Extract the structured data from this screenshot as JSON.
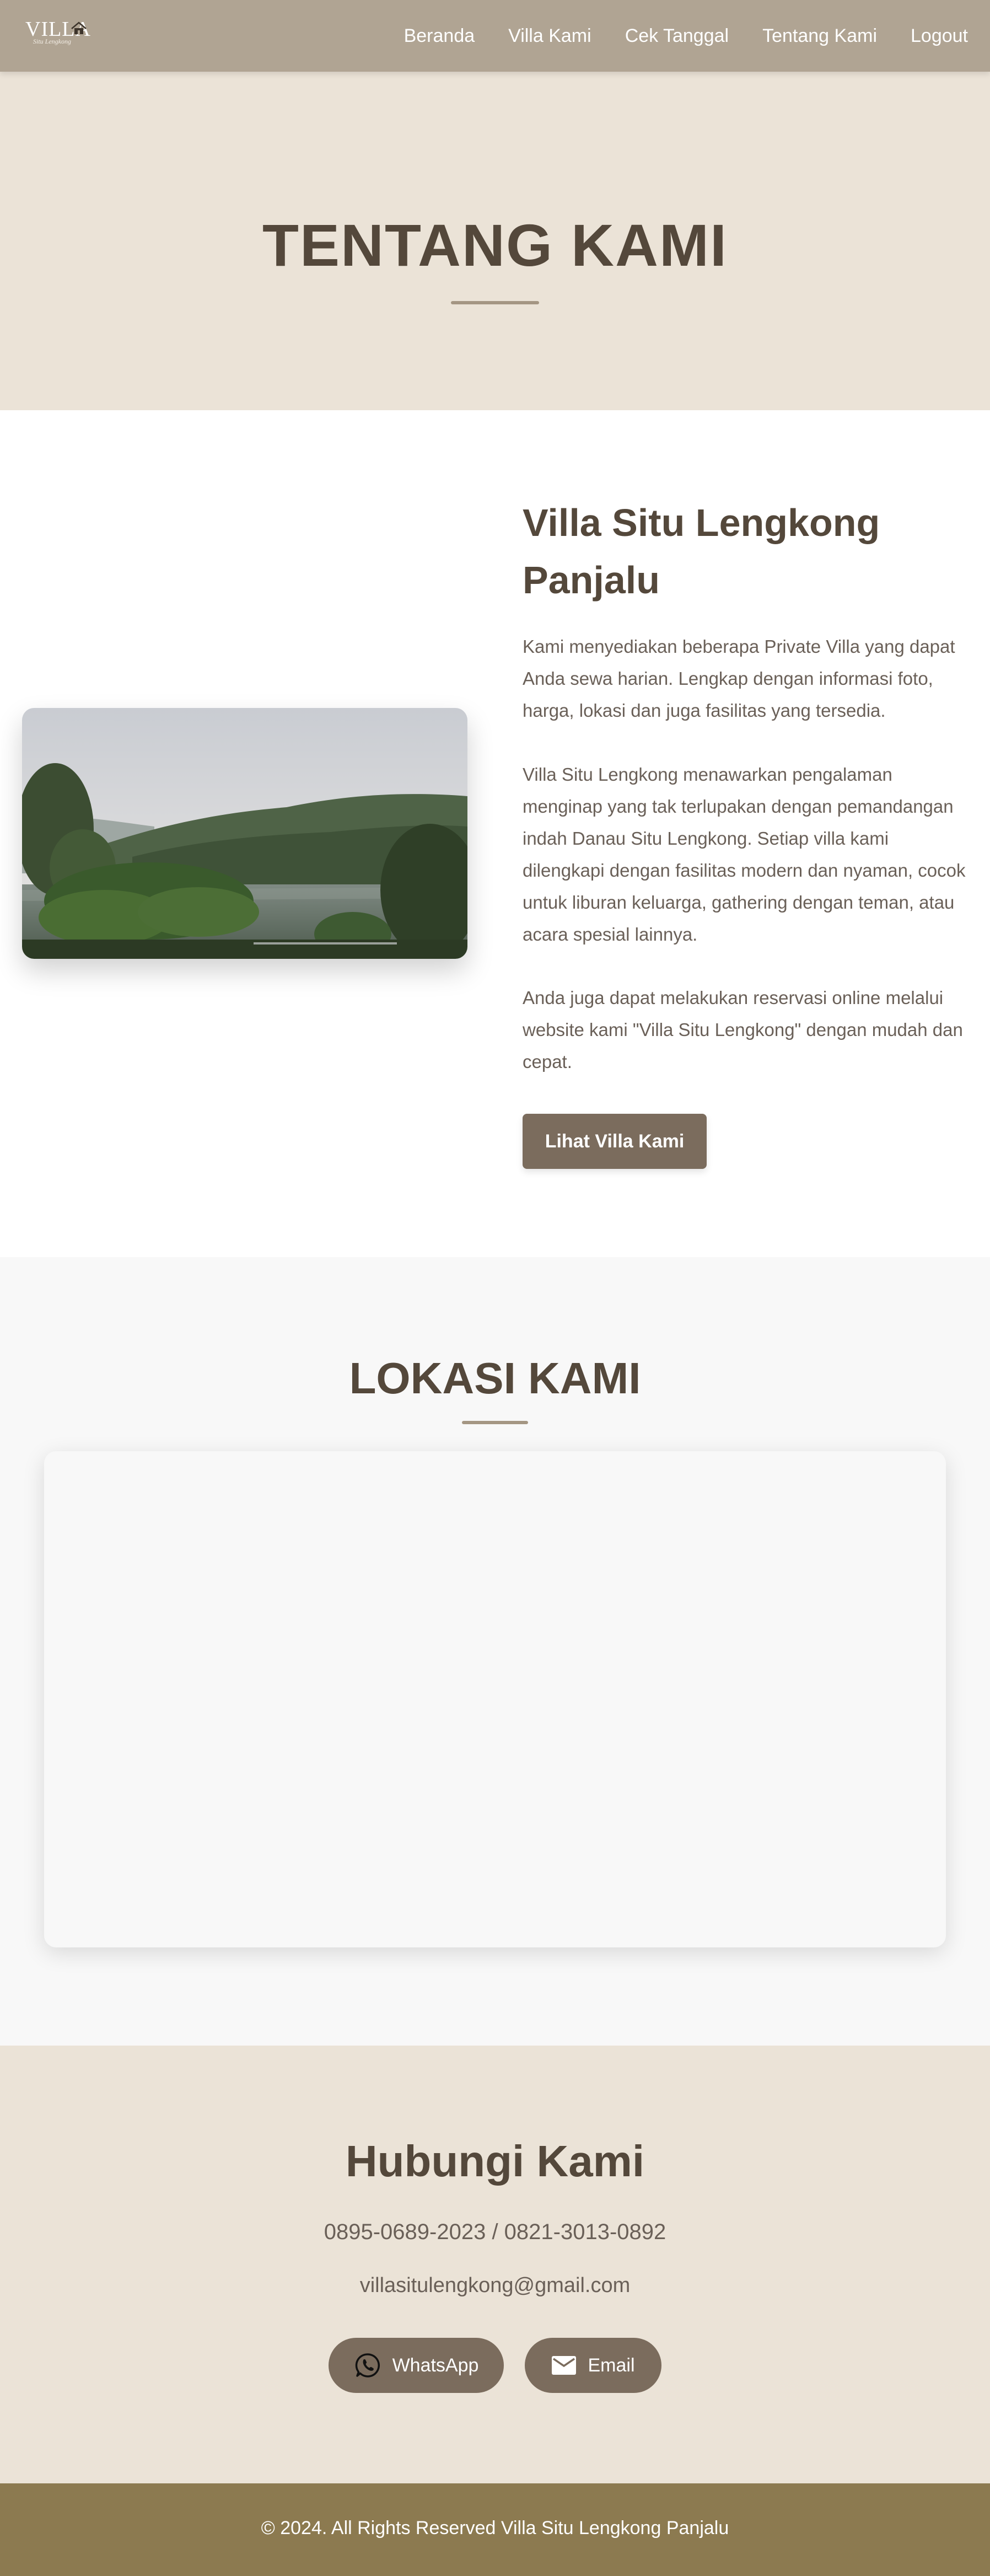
{
  "navbar": {
    "logo": {
      "text": "VILLA",
      "subtext": "Situ Lengkong",
      "icon": "house-icon"
    },
    "links": [
      "Beranda",
      "Villa Kami",
      "Cek Tanggal",
      "Tentang Kami",
      "Logout"
    ]
  },
  "hero": {
    "title": "TENTANG KAMI"
  },
  "about": {
    "title": "Villa Situ Lengkong Panjalu",
    "paragraphs": [
      "Kami menyediakan beberapa Private Villa yang dapat Anda sewa harian. Lengkap dengan informasi foto, harga, lokasi dan juga fasilitas yang tersedia.",
      "Villa Situ Lengkong menawarkan pengalaman menginap yang tak terlupakan dengan pemandangan indah Danau Situ Lengkong. Setiap villa kami dilengkapi dengan fasilitas modern dan nyaman, cocok untuk liburan keluarga, gathering dengan teman, atau acara spesial lainnya.",
      "Anda juga dapat melakukan reservasi online melalui website kami \"Villa Situ Lengkong\" dengan mudah dan cepat."
    ],
    "button": "Lihat Villa Kami"
  },
  "location": {
    "title": "LOKASI KAMI"
  },
  "contact": {
    "title": "Hubungi Kami",
    "phone": "0895-0689-2023 / 0821-3013-0892",
    "email": "villasitulengkong@gmail.com",
    "buttons": [
      {
        "label": "WhatsApp",
        "icon": "whatsapp-icon"
      },
      {
        "label": "Email",
        "icon": "mail-icon"
      }
    ]
  },
  "footer": {
    "text": "© 2024. All Rights Reserved Villa Situ Lengkong Panjalu"
  },
  "colors": {
    "navbar": "#b0a493",
    "hero_bg": "#ebe3d7",
    "heading": "#54483b",
    "button": "#7b6c5d",
    "footer": "#8c7a50"
  }
}
